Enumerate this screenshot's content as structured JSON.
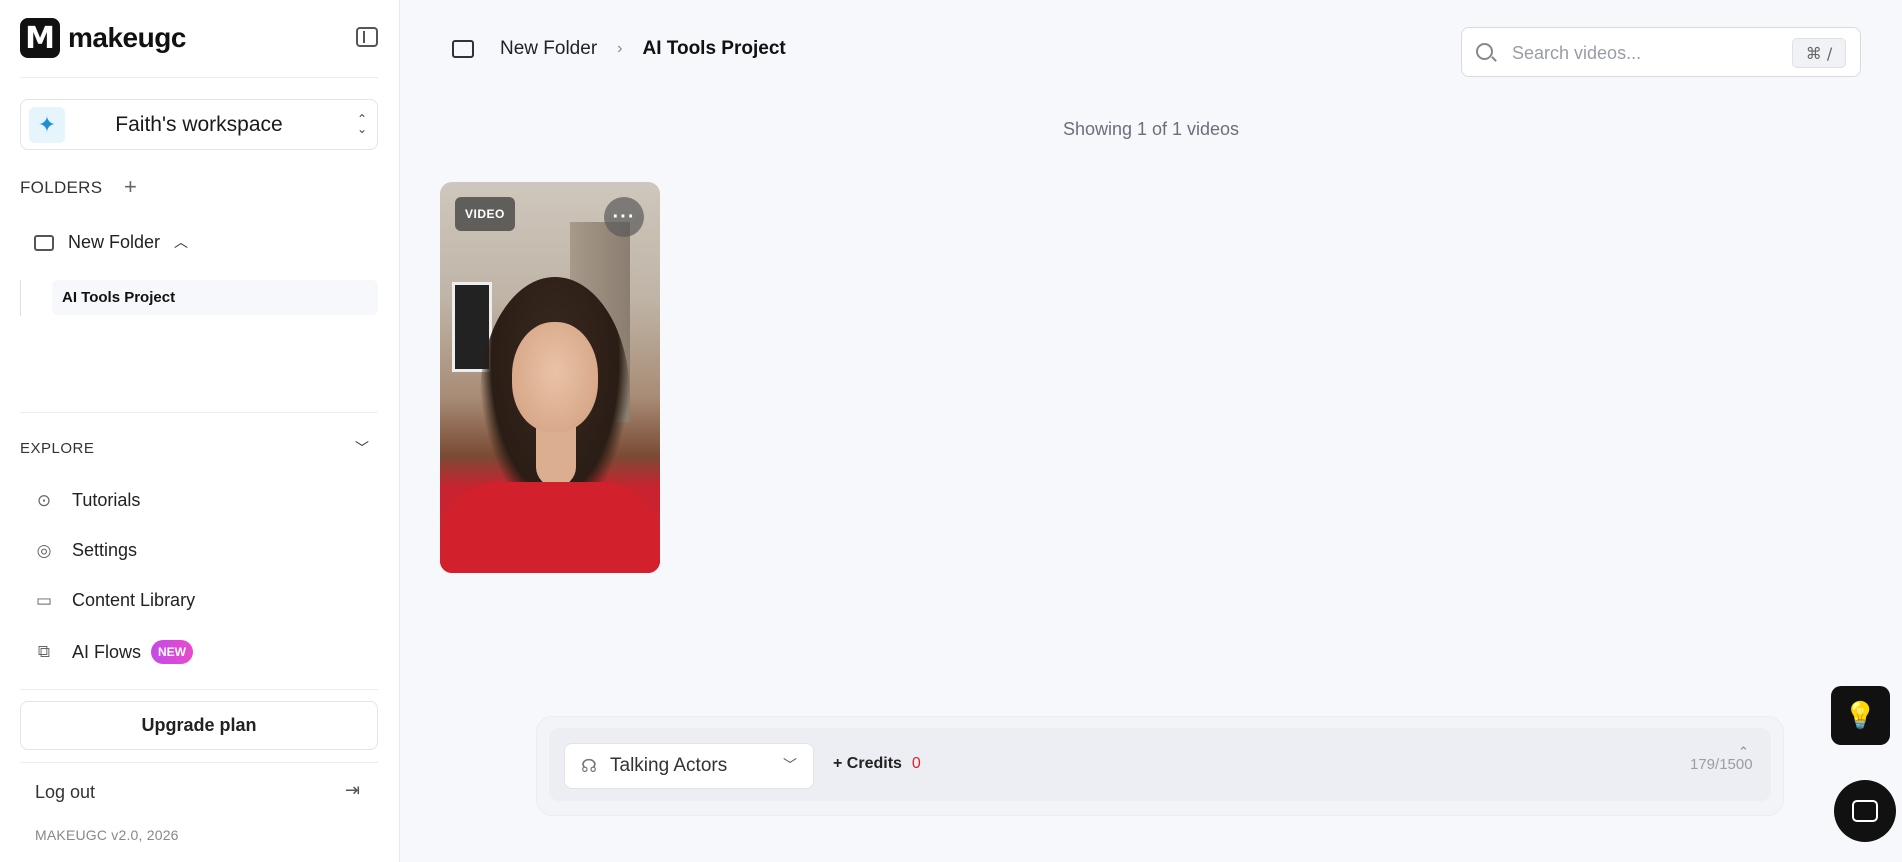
{
  "app": {
    "logo_letter": "M",
    "logo_text": "makeugc",
    "workspace": "Faith's workspace",
    "version": "MAKEUGC v2.0, 2026"
  },
  "sidebar": {
    "folders_label": "FOLDERS",
    "folders": [
      {
        "label": "New Folder",
        "expanded": true,
        "children": [
          {
            "label": "AI Tools Project",
            "selected": true
          }
        ]
      }
    ],
    "explore_label": "EXPLORE",
    "nav_items": [
      {
        "label": "Tutorials",
        "icon": "play-circle-icon"
      },
      {
        "label": "Settings",
        "icon": "settings-icon"
      },
      {
        "label": "Content Library",
        "icon": "folder-icon"
      },
      {
        "label": "AI Flows",
        "icon": "flows-icon",
        "badge": "NEW"
      }
    ],
    "upgrade_label": "Upgrade plan",
    "logout_label": "Log out"
  },
  "header": {
    "breadcrumb": [
      "New Folder",
      "AI Tools Project"
    ],
    "search_placeholder": "Search videos...",
    "search_value": "",
    "search_shortcut": "⌘ /"
  },
  "main": {
    "showing_text": "Showing 1 of 1 videos",
    "videos": [
      {
        "badge": "VIDEO",
        "more": "···"
      }
    ]
  },
  "composer": {
    "actor_select": "Talking Actors",
    "credits_label": "+ Credits",
    "credits_value": "0",
    "char_counter": "179/1500"
  },
  "colors": {
    "accent_badge_gradient_start": "#c44ae8",
    "accent_badge_gradient_end": "#e84acb",
    "credits_zero": "#e0232e",
    "workspace_icon": "#1d8fd6"
  }
}
